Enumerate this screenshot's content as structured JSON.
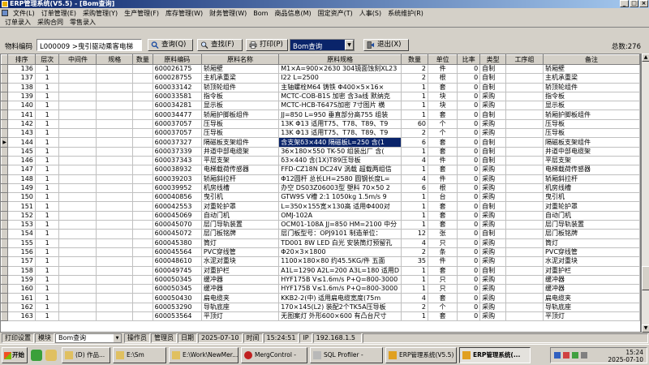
{
  "window": {
    "title": "ERP管理系统(V5.5) - [Bom查询]"
  },
  "menu": {
    "row1": [
      "文件(L)",
      "订单管理(E)",
      "采购管理(Y)",
      "生产管理(F)",
      "库存管理(W)",
      "财务管理(W)",
      "Bom",
      "商品信息(M)",
      "固定资产(T)",
      "人事(S)",
      "系统维护(R)"
    ],
    "row2": [
      "订单录入",
      "采购合同",
      "零售录入"
    ]
  },
  "toolbar": {
    "code_label": "物料编码",
    "code_value": "L000009 >曳引驱动乘客电梯",
    "query_label": "查询(Q)",
    "find_label": "查找(F)",
    "print_label": "打印(P)",
    "report_value": "Bom查询",
    "exit_label": "退出(X)",
    "total": "总数:276"
  },
  "table": {
    "headers": [
      "排序",
      "层次",
      "中间件",
      "规格",
      "数量",
      "原料编码",
      "原料名称",
      "原料规格",
      "数量",
      "单位",
      "比率",
      "类型",
      "工序组",
      "备注"
    ],
    "selected_index": 8,
    "rows": [
      [
        "136",
        "1",
        "",
        "",
        "",
        "600026175",
        "轿厢壁",
        "M1×A=900×2630 304镜面蚀刻XL23",
        "2",
        "件",
        "0",
        "自制",
        "",
        "轿厢壁"
      ],
      [
        "137",
        "1",
        "",
        "",
        "",
        "600028755",
        "主机承重梁",
        "I22 L=2500",
        "2",
        "根",
        "0",
        "自制",
        "",
        "主机承重梁"
      ],
      [
        "138",
        "1",
        "",
        "",
        "",
        "600033142",
        "轿顶轮组件",
        "主轴螺栓M64 铸铁 Φ400×5×16×",
        "1",
        "套",
        "0",
        "自制",
        "",
        "轿顶轮组件"
      ],
      [
        "139",
        "1",
        "",
        "",
        "",
        "600033581",
        "指令板",
        "MCTC-COB-B1S 加密 含3a线 默纳克",
        "1",
        "块",
        "0",
        "采购",
        "",
        "指令板"
      ],
      [
        "140",
        "1",
        "",
        "",
        "",
        "600034281",
        "显示板",
        "MCTC-HCB-T647S加密 7寸图片 横",
        "1",
        "块",
        "0",
        "采购",
        "",
        "显示板"
      ],
      [
        "141",
        "1",
        "",
        "",
        "",
        "600034477",
        "轿厢护脚板组件",
        "JJ=850 L=950 垂直部分高755 组装",
        "1",
        "套",
        "0",
        "自制",
        "",
        "轿厢护脚板组件"
      ],
      [
        "142",
        "1",
        "",
        "",
        "",
        "600037057",
        "压导板",
        "13K Φ13 适用T75、T78、T89、T9",
        "60",
        "个",
        "0",
        "采购",
        "",
        "压导板"
      ],
      [
        "143",
        "1",
        "",
        "",
        "",
        "600037057",
        "压导板",
        "13K Φ13 适用T75、T78、T89、T9",
        "2",
        "个",
        "0",
        "采购",
        "",
        "压导板"
      ],
      [
        "144",
        "1",
        "",
        "",
        "",
        "600037327",
        "隔磁板支架组件",
        "含支架δ3×440 隔磁板L=250 含(1",
        "6",
        "套",
        "0",
        "自制",
        "",
        "隔磁板支架组件"
      ],
      [
        "145",
        "1",
        "",
        "",
        "",
        "600037339",
        "井道中部电缆架",
        "36×180×550 TK-50 组装出厂 含(",
        "1",
        "套",
        "0",
        "自制",
        "",
        "井道中部电缆架"
      ],
      [
        "146",
        "1",
        "",
        "",
        "",
        "600037343",
        "平层支架",
        "δ3×440 含(1X)T89压导板",
        "4",
        "件",
        "0",
        "自制",
        "",
        "平层支架"
      ],
      [
        "147",
        "1",
        "",
        "",
        "",
        "600038932",
        "电梯载荷传感器",
        "FFD-CZ18N DC24V 涡载 超载两组信",
        "1",
        "套",
        "0",
        "采购",
        "",
        "电梯载荷传感器"
      ],
      [
        "148",
        "1",
        "",
        "",
        "",
        "600039203",
        "轿厢斜拉杆",
        "Φ12圆杆 总长LH=2580 圆钢长度L=",
        "4",
        "件",
        "0",
        "采购",
        "",
        "轿厢斜拉杆"
      ],
      [
        "149",
        "1",
        "",
        "",
        "",
        "600039952",
        "机房线槽",
        "办空 DS03Z06003型 塑料 70×50 2",
        "6",
        "根",
        "0",
        "采购",
        "",
        "机房线槽"
      ],
      [
        "150",
        "1",
        "",
        "",
        "",
        "600040856",
        "曳引机",
        "GTW9S V槽 2:1 1050kg 1.5m/s 9",
        "1",
        "台",
        "0",
        "采购",
        "",
        "曳引机"
      ],
      [
        "151",
        "1",
        "",
        "",
        "",
        "600042553",
        "对重轮护罩",
        "L=350×155宽×130高 适用Φ400对",
        "1",
        "套",
        "0",
        "自制",
        "",
        "对重轮护罩"
      ],
      [
        "152",
        "1",
        "",
        "",
        "",
        "600045069",
        "自动门机",
        "OMJ-102A",
        "1",
        "套",
        "0",
        "采购",
        "",
        "自动门机"
      ],
      [
        "153",
        "1",
        "",
        "",
        "",
        "600045070",
        "层门导轨装置",
        "OCM01-108A JJ=850 HM=2100 中分",
        "1",
        "套",
        "0",
        "采购",
        "",
        "层门导轨装置"
      ],
      [
        "154",
        "1",
        "",
        "",
        "",
        "600045072",
        "层门板铭牌",
        "层门板型号：OPJ9101 制造单位：",
        "12",
        "张",
        "0",
        "自制",
        "",
        "层门板铭牌"
      ],
      [
        "155",
        "1",
        "",
        "",
        "",
        "600045380",
        "筒灯",
        "TD001 8W LED 白光 安装筒灯预留孔",
        "4",
        "只",
        "0",
        "采购",
        "",
        "筒灯"
      ],
      [
        "156",
        "1",
        "",
        "",
        "",
        "600045564",
        "PVC穿线管",
        "Φ20×3×1800",
        "2",
        "条",
        "0",
        "采购",
        "",
        "PVC穿线管"
      ],
      [
        "157",
        "1",
        "",
        "",
        "",
        "600048610",
        "水泥对重块",
        "1100×180×80 约45.5KG/件 五面",
        "35",
        "件",
        "0",
        "采购",
        "",
        "水泥对重块"
      ],
      [
        "158",
        "1",
        "",
        "",
        "",
        "600049745",
        "对重护栏",
        "A1L=1290 A2L=200 A3L=180 适用D",
        "1",
        "套",
        "0",
        "自制",
        "",
        "对重护栏"
      ],
      [
        "159",
        "1",
        "",
        "",
        "",
        "600050345",
        "缓冲器",
        "HYF175B V≤1.6m/s P+Q=800-3000",
        "1",
        "只",
        "0",
        "采购",
        "",
        "缓冲器"
      ],
      [
        "160",
        "1",
        "",
        "",
        "",
        "600050345",
        "缓冲器",
        "HYF175B V≤1.6m/s P+Q=800-3000",
        "1",
        "只",
        "0",
        "采购",
        "",
        "缓冲器"
      ],
      [
        "161",
        "1",
        "",
        "",
        "",
        "600050430",
        "扁电缆夹",
        "KKB2-2(中) 适用扁电缆宽度(75m",
        "4",
        "套",
        "0",
        "采购",
        "",
        "扁电缆夹"
      ],
      [
        "162",
        "1",
        "",
        "",
        "",
        "600053290",
        "导轨底座",
        "170×145(L2) 装配2个TK5A压导板",
        "2",
        "个",
        "0",
        "采购",
        "",
        "导轨底座"
      ],
      [
        "163",
        "1",
        "",
        "",
        "",
        "600053564",
        "平顶灯",
        "无图案灯 外形600×600 有凸台尺寸",
        "1",
        "套",
        "0",
        "采购",
        "",
        "平顶灯"
      ]
    ]
  },
  "status": {
    "print_label": "打印设置",
    "module_label": "模块",
    "module_value": "Bom查询",
    "operator_label": "操作员",
    "operator_value": "管理员",
    "date_label": "日期",
    "date_value": "2025-07-10",
    "time_label": "时间",
    "time_value": "15:24:51",
    "ip_label": "IP",
    "ip_value": "192.168.1.5"
  },
  "taskbar": {
    "start_label": "开始",
    "tasks": [
      "(D) 作品...",
      "E:\\Sm",
      "E:\\Work\\NewMer...",
      "MergControl -",
      "SQL Profiler -",
      "ERP管理系统(V5.5)",
      "ERP管理系统(..."
    ],
    "clock_time": "15:24",
    "clock_date": "2025-07-10"
  },
  "colors": {
    "title_start": "#0a246a",
    "title_end": "#a6caf0",
    "selection": "#0a246a",
    "face": "#d4d0c8"
  }
}
